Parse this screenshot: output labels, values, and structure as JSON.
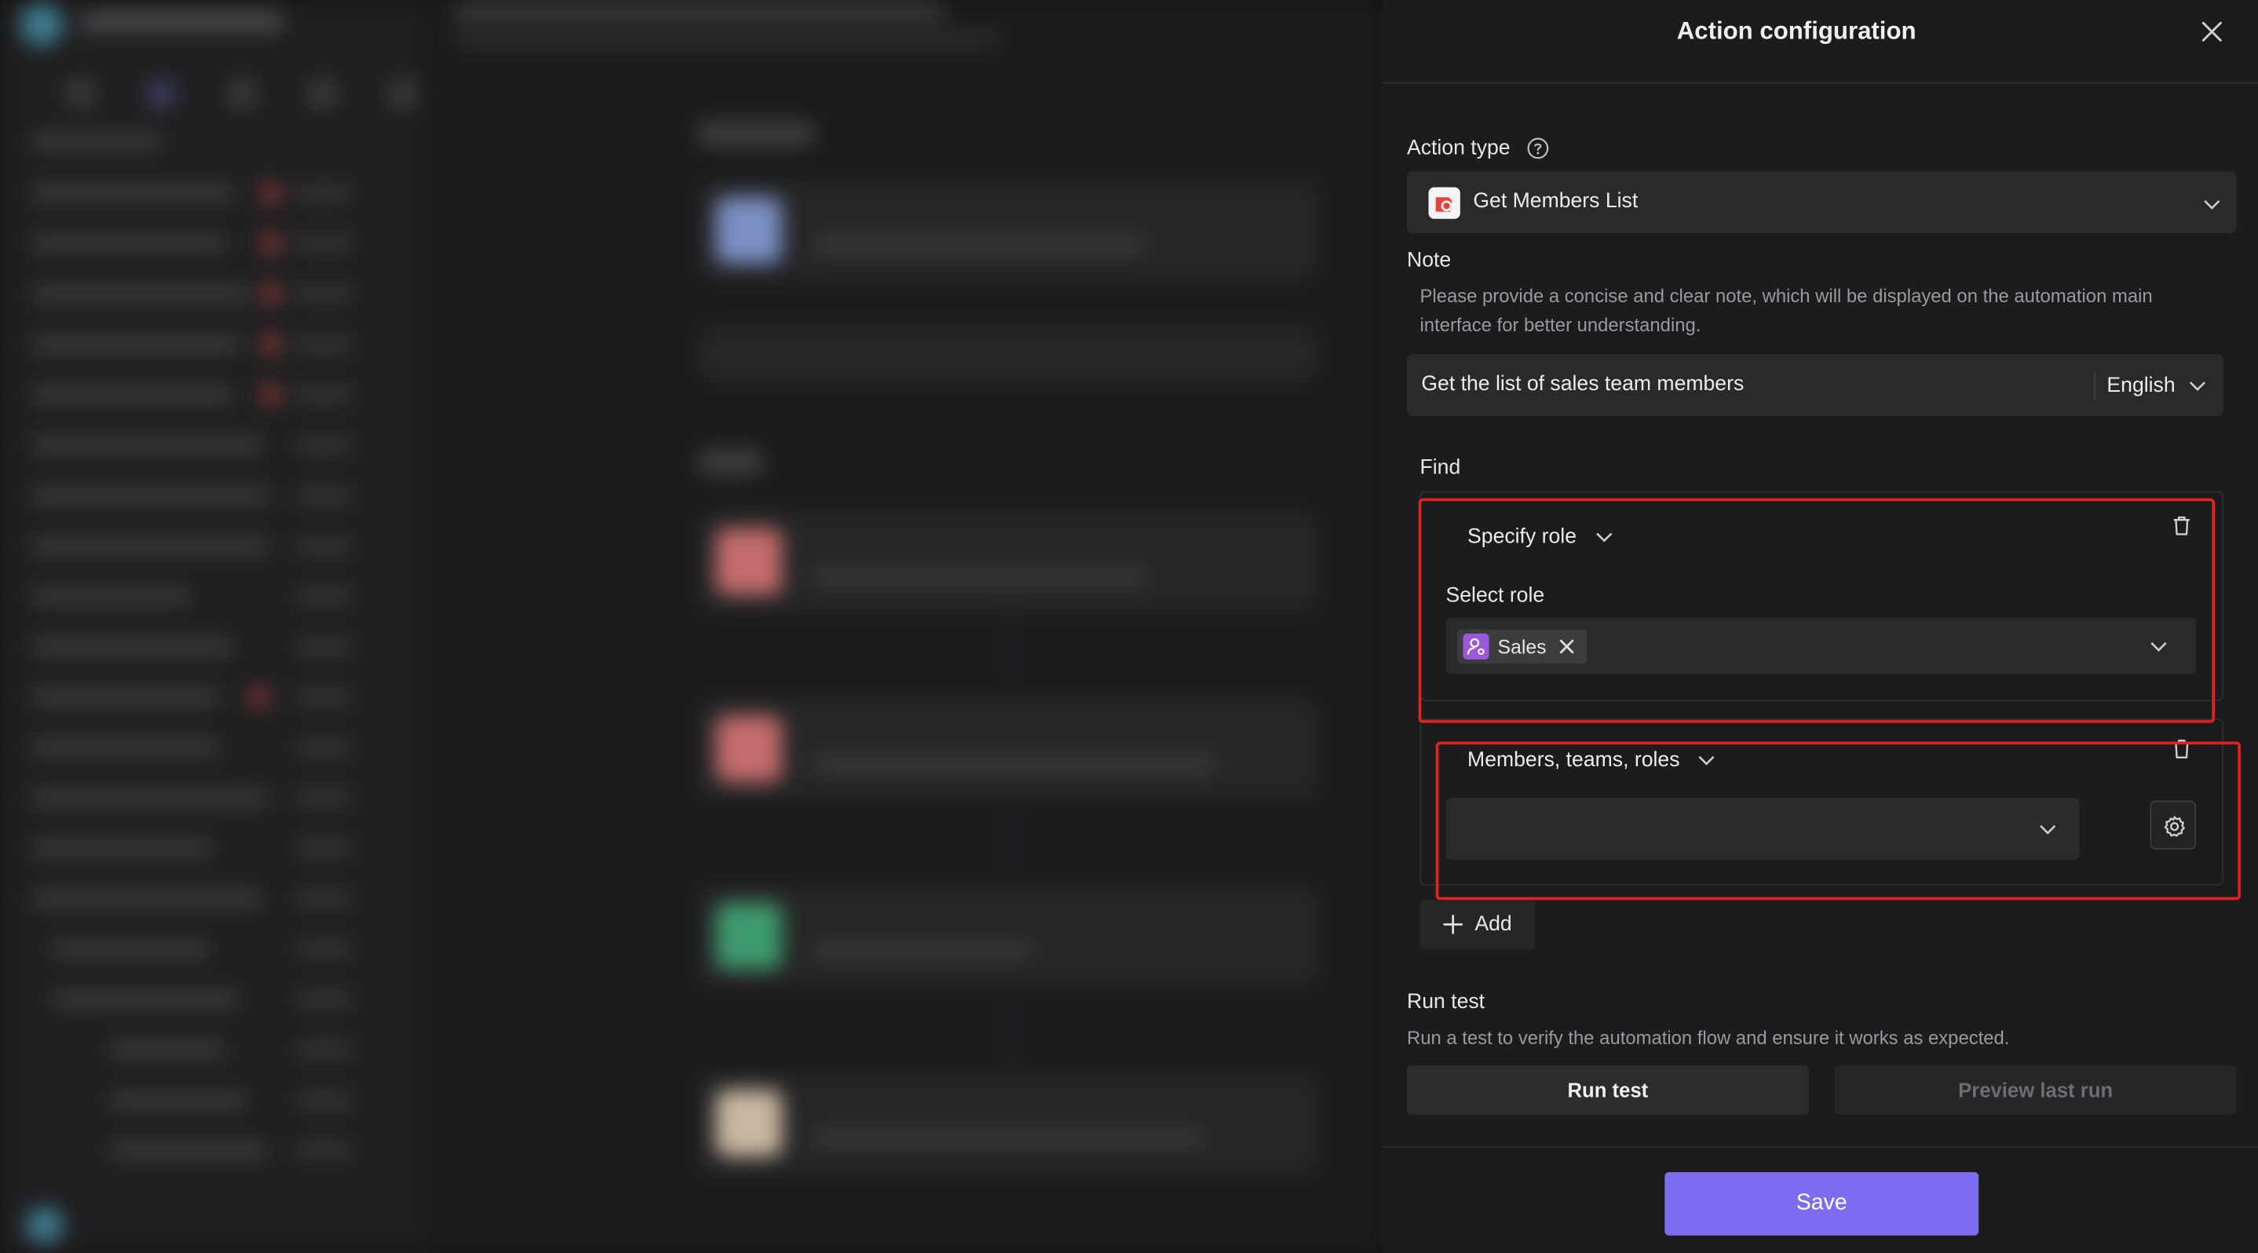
{
  "drawer": {
    "title": "Action configuration",
    "action_type": {
      "label": "Action type",
      "value": "Get Members List"
    },
    "note": {
      "label": "Note",
      "description": "Please provide a concise and clear note, which will be displayed on the automation main interface for better understanding.",
      "value": "Get the list of sales team members",
      "language": "English"
    },
    "find": {
      "label": "Find",
      "conditions": [
        {
          "type": "Specify role",
          "sub_label": "Select role",
          "chips": [
            "Sales"
          ]
        },
        {
          "type": "Members, teams, roles",
          "value": ""
        }
      ],
      "add_label": "Add"
    },
    "run_test": {
      "label": "Run test",
      "description": "Run a test to verify the automation flow and ensure it works as expected.",
      "run_button": "Run test",
      "preview_button": "Preview last run"
    },
    "save_button": "Save"
  },
  "colors": {
    "accent": "#7b6cf0",
    "highlight": "#e6201c",
    "chip_icon": "#9b59d8"
  }
}
